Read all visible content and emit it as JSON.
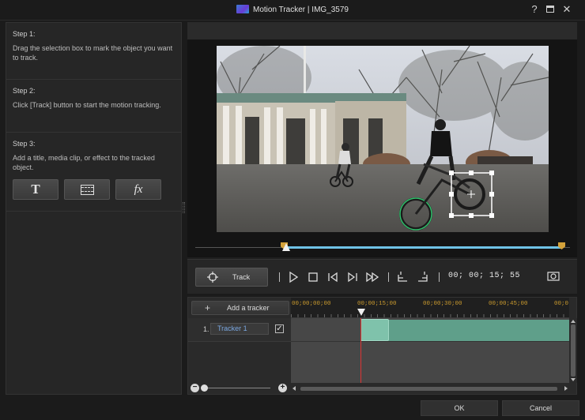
{
  "window": {
    "title": "Motion Tracker  |  IMG_3579",
    "help": "?",
    "close": "✕"
  },
  "steps": [
    {
      "heading": "Step 1:",
      "text": "Drag the selection box to mark the object you want to track."
    },
    {
      "heading": "Step 2:",
      "text": "Click [Track] button to start the motion tracking."
    },
    {
      "heading": "Step 3:",
      "text": "Add a title, media clip, or effect to the tracked object."
    }
  ],
  "add_buttons": {
    "title_icon": "T",
    "media_icon": "clip-icon",
    "effect_icon": "fx"
  },
  "controls": {
    "track_label": "Track",
    "timecode": "00; 00; 15; 55",
    "icons": [
      "play-icon",
      "stop-icon",
      "previous-frame-icon",
      "next-frame-icon",
      "fast-forward-icon",
      "mark-in-icon",
      "mark-out-icon",
      "snapshot-icon"
    ]
  },
  "timeline": {
    "add_tracker_label": "Add a tracker",
    "ruler_labels": [
      "00;00;00;00",
      "00;00;15;00",
      "00;00;30;00",
      "00;00;45;00",
      "00;0"
    ],
    "tracker": {
      "index": "1.",
      "name": "Tracker 1",
      "checked": true
    }
  },
  "footer": {
    "ok_label": "OK",
    "cancel_label": "Cancel"
  },
  "colors": {
    "accent_timecode": "#c99a2e",
    "scrub_range": "#6fc3e6",
    "clip_fill": "#5f9f8a",
    "playhead": "#dd3333",
    "tracker_name": "#7aa7e0"
  }
}
